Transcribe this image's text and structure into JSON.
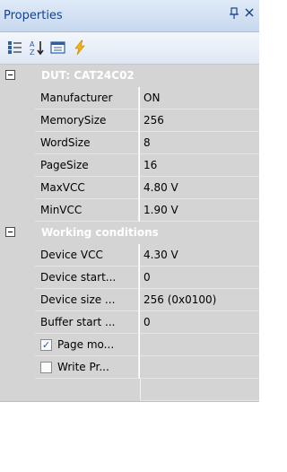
{
  "panel": {
    "title": "Properties",
    "pin_icon": "pin-icon",
    "close_icon": "close-icon"
  },
  "toolbar": {
    "buttons": [
      {
        "name": "categorized-icon"
      },
      {
        "name": "alphabetical-icon"
      },
      {
        "name": "property-pages-icon"
      },
      {
        "name": "events-icon"
      }
    ]
  },
  "categories": [
    {
      "label": "DUT: CAT24C02",
      "properties": [
        {
          "name": "Manufacturer",
          "value": "ON"
        },
        {
          "name": "MemorySize",
          "value": "256"
        },
        {
          "name": "WordSize",
          "value": "8"
        },
        {
          "name": "PageSize",
          "value": "16"
        },
        {
          "name": "MaxVCC",
          "value": "4.80 V"
        },
        {
          "name": "MinVCC",
          "value": "1.90 V"
        }
      ]
    },
    {
      "label": "Working conditions",
      "properties": [
        {
          "name": "Device VCC",
          "value": "4.30 V"
        },
        {
          "name": "Device start...",
          "value": "0"
        },
        {
          "name": "Device size ...",
          "value": "256 (0x0100)"
        },
        {
          "name": "Buffer start ...",
          "value": "0"
        },
        {
          "name": "Page mo...",
          "checked": true,
          "value": ""
        },
        {
          "name": "Write Pr...",
          "checked": false,
          "value": ""
        }
      ]
    }
  ],
  "colors": {
    "title_text": "#15428b",
    "grid_background": "#d4d4d4",
    "category_text": "#ffffff"
  }
}
